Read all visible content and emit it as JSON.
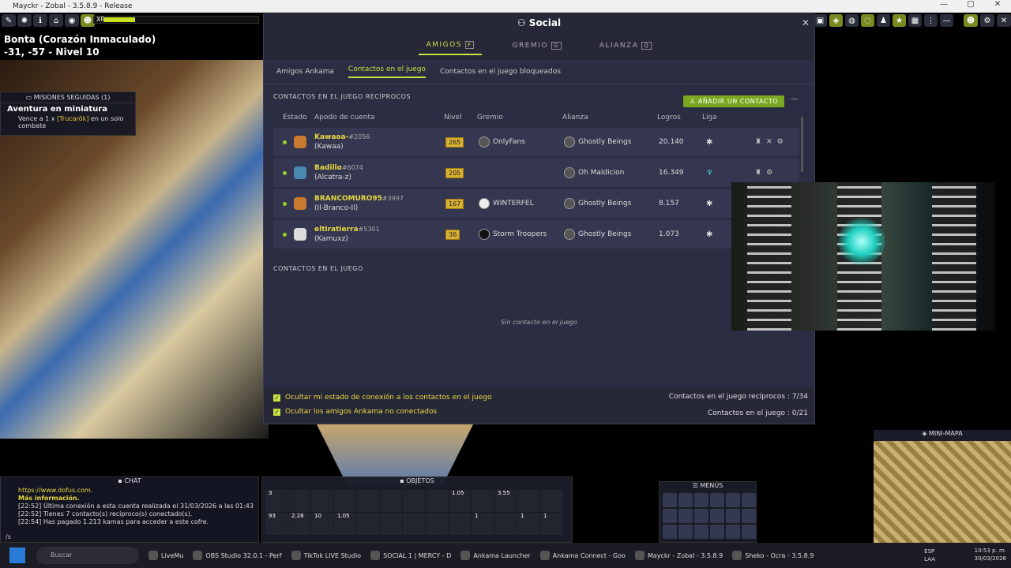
{
  "window": {
    "title": "Mayckr - Zobal - 3.5.8.9 - Release"
  },
  "hud": {
    "xp_label": "XP",
    "xp_progress": 0.2,
    "location_line1": "Bonta (Corazón Inmaculado)",
    "location_line2": "-31, -57 - Nivel 10"
  },
  "quest": {
    "header": "MISIONES SEGUIDAS (1)",
    "title": "Aventura en miniatura",
    "desc_prefix": "Vence a 1 x",
    "desc_target": "[Trucarök]",
    "desc_suffix": "en un solo combate"
  },
  "social": {
    "title": "Social",
    "tabs": [
      {
        "label": "AMIGOS",
        "key": "F"
      },
      {
        "label": "GREMIO",
        "key": "G"
      },
      {
        "label": "ALIANZA",
        "key": "Q"
      }
    ],
    "subtabs": [
      "Amigos Ankama",
      "Contactos en el juego",
      "Contactos en el juego bloqueados"
    ],
    "section_reciprocal": "CONTACTOS EN EL JUEGO RECÍPROCOS",
    "add_button": "AÑADIR UN CONTACTO",
    "columns": [
      "Estado",
      "Apodo de cuenta",
      "Nivel",
      "Gremio",
      "Alianza",
      "Logros",
      "Liga"
    ],
    "rows": [
      {
        "name": "Kawaaa-",
        "tag": "#2056",
        "account": "(Kawaa)",
        "level": "265",
        "guild": "OnlyFans",
        "alliance": "Ghostly Beings",
        "achievements": "20.140"
      },
      {
        "name": "Badillo",
        "tag": "#6074",
        "account": "(Alcatra-z)",
        "level": "205",
        "guild": "",
        "alliance": "Oh Maldicion",
        "achievements": "16.349"
      },
      {
        "name": "BRANCOMURO95",
        "tag": "#3997",
        "account": "(Il-Branco-Il)",
        "level": "167",
        "guild": "WINTERFEL",
        "alliance": "Ghostly Beings",
        "achievements": "8.157"
      },
      {
        "name": "eltiratierra",
        "tag": "#5301",
        "account": "(Kamuxz)",
        "level": "36",
        "guild": "Storm Troopers",
        "alliance": "Ghostly Beings",
        "achievements": "1.073"
      }
    ],
    "section_ingame": "CONTACTOS EN EL JUEGO",
    "empty_message": "Sin contacto en el juego",
    "footer": {
      "check1": "Ocultar mi estado de conexión a los contactos en el juego",
      "check2": "Ocultar los amigos Ankama no conectados",
      "count1": "Contactos en el juego recíprocos : 7/34",
      "count2": "Contactos en el juego : 0/21"
    }
  },
  "chat": {
    "header": "CHAT",
    "lines": [
      "https://www.dofus.com.",
      "Más información.",
      "[22:52] Última conexión a esta cuenta realizada el 31/03/2026 a las 01:43",
      "[22:52] Tienes 7 contacto(s) recíproco(s) conectado(s).",
      "[22:54] Has pagado 1.213 kamas para acceder a este cofre."
    ],
    "input": "/s"
  },
  "objects": {
    "header": "OBJETOS",
    "counts": [
      "3",
      "",
      "",
      "",
      "",
      "",
      "",
      "",
      "1.05",
      "",
      "3.55",
      "",
      "",
      "93",
      "2.28",
      "10",
      "1.05",
      "",
      "",
      "",
      "",
      "",
      "1",
      "",
      "1",
      "1"
    ]
  },
  "menus": {
    "header": "MENÚS"
  },
  "minimap": {
    "header": "MINI-MAPA"
  },
  "taskbar": {
    "search": "Buscar",
    "apps": [
      "LiveMu",
      "OBS Studio 32.0.1 - Perf",
      "TikTok LIVE Studio",
      "SOCIAL 1 | MERCY - D",
      "Ankama Launcher",
      "Ankama Connect - Goo",
      "Mayckr - Zobal - 3.5.8.9",
      "Sheko - Ocra - 3.5.8.9"
    ],
    "lang1": "ESP",
    "lang2": "LAA",
    "time": "10:53 p. m.",
    "date": "30/03/2026"
  }
}
